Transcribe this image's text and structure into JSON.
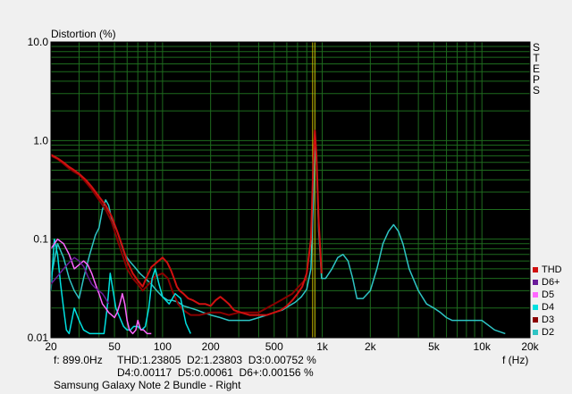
{
  "chart_data": {
    "type": "line",
    "title": "Distortion (%)",
    "xlabel": "f (Hz)",
    "x_scale": "log",
    "y_scale": "log",
    "xlim": [
      20,
      20000
    ],
    "ylim": [
      0.01,
      10.0
    ],
    "y_ticks": [
      "10.0",
      "1.0",
      "0.1",
      "0.01"
    ],
    "x_ticks": [
      {
        "v": 20,
        "label": "20"
      },
      {
        "v": 50,
        "label": "50"
      },
      {
        "v": 100,
        "label": "100"
      },
      {
        "v": 200,
        "label": "200"
      },
      {
        "v": 500,
        "label": "500"
      },
      {
        "v": 1000,
        "label": "1k"
      },
      {
        "v": 2000,
        "label": "2k"
      },
      {
        "v": 5000,
        "label": "5k"
      },
      {
        "v": 10000,
        "label": "10k"
      },
      {
        "v": 20000,
        "label": "20k"
      }
    ],
    "grid": true,
    "background": "#000000",
    "grid_color": "#1e6b1e",
    "cursor_frequency": 899,
    "legend_position": "right",
    "series": [
      {
        "name": "D2",
        "color": "#2ec4c4",
        "points": [
          [
            20,
            0.04
          ],
          [
            22,
            0.09
          ],
          [
            24,
            0.065
          ],
          [
            26,
            0.04
          ],
          [
            28,
            0.03
          ],
          [
            30,
            0.025
          ],
          [
            32,
            0.04
          ],
          [
            35,
            0.07
          ],
          [
            38,
            0.11
          ],
          [
            40,
            0.13
          ],
          [
            42,
            0.2
          ],
          [
            44,
            0.25
          ],
          [
            46,
            0.22
          ],
          [
            48,
            0.16
          ],
          [
            52,
            0.12
          ],
          [
            55,
            0.09
          ],
          [
            58,
            0.07
          ],
          [
            62,
            0.06
          ],
          [
            67,
            0.052
          ],
          [
            72,
            0.045
          ],
          [
            78,
            0.04
          ],
          [
            85,
            0.035
          ],
          [
            92,
            0.03
          ],
          [
            100,
            0.026
          ],
          [
            108,
            0.024
          ],
          [
            115,
            0.024
          ],
          [
            125,
            0.023
          ],
          [
            135,
            0.021
          ],
          [
            150,
            0.02
          ],
          [
            165,
            0.019
          ],
          [
            180,
            0.018
          ],
          [
            200,
            0.017
          ],
          [
            230,
            0.016
          ],
          [
            260,
            0.015
          ],
          [
            300,
            0.015
          ],
          [
            350,
            0.015
          ],
          [
            400,
            0.016
          ],
          [
            450,
            0.017
          ],
          [
            500,
            0.018
          ],
          [
            560,
            0.019
          ],
          [
            620,
            0.021
          ],
          [
            680,
            0.023
          ],
          [
            740,
            0.026
          ],
          [
            800,
            0.031
          ],
          [
            850,
            0.05
          ],
          [
            880,
            0.25
          ],
          [
            899,
            1.23803
          ],
          [
            920,
            0.6
          ],
          [
            950,
            0.12
          ],
          [
            990,
            0.04
          ],
          [
            1050,
            0.04
          ],
          [
            1150,
            0.05
          ],
          [
            1250,
            0.065
          ],
          [
            1350,
            0.07
          ],
          [
            1450,
            0.06
          ],
          [
            1550,
            0.04
          ],
          [
            1650,
            0.025
          ],
          [
            1800,
            0.025
          ],
          [
            2000,
            0.03
          ],
          [
            2200,
            0.05
          ],
          [
            2400,
            0.09
          ],
          [
            2600,
            0.12
          ],
          [
            2800,
            0.14
          ],
          [
            3000,
            0.12
          ],
          [
            3200,
            0.09
          ],
          [
            3500,
            0.05
          ],
          [
            4000,
            0.03
          ],
          [
            4500,
            0.022
          ],
          [
            5000,
            0.02
          ],
          [
            5500,
            0.018
          ],
          [
            6000,
            0.016
          ],
          [
            6500,
            0.015
          ],
          [
            7000,
            0.015
          ],
          [
            8000,
            0.015
          ],
          [
            9000,
            0.015
          ],
          [
            10000,
            0.015
          ],
          [
            12000,
            0.012
          ],
          [
            14000,
            0.011
          ]
        ]
      },
      {
        "name": "D3",
        "color": "#8b0000",
        "points": [
          [
            20,
            0.7
          ],
          [
            22,
            0.65
          ],
          [
            24,
            0.58
          ],
          [
            26,
            0.52
          ],
          [
            28,
            0.48
          ],
          [
            30,
            0.45
          ],
          [
            33,
            0.38
          ],
          [
            36,
            0.32
          ],
          [
            40,
            0.25
          ],
          [
            44,
            0.2
          ],
          [
            48,
            0.15
          ],
          [
            52,
            0.1
          ],
          [
            56,
            0.07
          ],
          [
            60,
            0.05
          ],
          [
            65,
            0.04
          ],
          [
            70,
            0.035
          ],
          [
            75,
            0.03
          ],
          [
            82,
            0.035
          ],
          [
            90,
            0.042
          ],
          [
            100,
            0.045
          ],
          [
            108,
            0.04
          ],
          [
            115,
            0.03
          ],
          [
            125,
            0.022
          ],
          [
            135,
            0.019
          ],
          [
            150,
            0.017
          ],
          [
            170,
            0.017
          ],
          [
            200,
            0.018
          ],
          [
            230,
            0.018
          ],
          [
            260,
            0.017
          ],
          [
            300,
            0.018
          ],
          [
            350,
            0.018
          ],
          [
            400,
            0.018
          ],
          [
            450,
            0.02
          ],
          [
            500,
            0.022
          ],
          [
            550,
            0.024
          ],
          [
            600,
            0.026
          ],
          [
            650,
            0.028
          ],
          [
            700,
            0.032
          ],
          [
            750,
            0.036
          ],
          [
            800,
            0.04
          ]
        ]
      },
      {
        "name": "D4",
        "color": "#00e0e0",
        "points": [
          [
            20,
            0.03
          ],
          [
            21,
            0.1
          ],
          [
            22,
            0.07
          ],
          [
            23,
            0.035
          ],
          [
            24,
            0.02
          ],
          [
            25,
            0.012
          ],
          [
            26,
            0.011
          ],
          [
            28,
            0.02
          ],
          [
            30,
            0.015
          ],
          [
            32,
            0.012
          ],
          [
            35,
            0.011
          ],
          [
            38,
            0.011
          ],
          [
            40,
            0.011
          ],
          [
            43,
            0.011
          ],
          [
            45,
            0.02
          ],
          [
            47,
            0.045
          ],
          [
            49,
            0.03
          ],
          [
            51,
            0.02
          ],
          [
            54,
            0.016
          ],
          [
            57,
            0.013
          ],
          [
            60,
            0.012
          ],
          [
            63,
            0.012
          ],
          [
            66,
            0.013
          ],
          [
            70,
            0.013
          ],
          [
            74,
            0.012
          ],
          [
            78,
            0.013
          ],
          [
            82,
            0.02
          ],
          [
            86,
            0.04
          ],
          [
            90,
            0.05
          ],
          [
            95,
            0.035
          ],
          [
            100,
            0.026
          ],
          [
            110,
            0.022
          ],
          [
            120,
            0.028
          ],
          [
            130,
            0.025
          ],
          [
            140,
            0.014
          ],
          [
            150,
            0.011
          ]
        ]
      },
      {
        "name": "D5",
        "color": "#ff66ff",
        "points": [
          [
            20,
            0.08
          ],
          [
            22,
            0.1
          ],
          [
            24,
            0.09
          ],
          [
            26,
            0.07
          ],
          [
            28,
            0.05
          ],
          [
            30,
            0.055
          ],
          [
            32,
            0.06
          ],
          [
            34,
            0.055
          ],
          [
            36,
            0.045
          ],
          [
            38,
            0.035
          ],
          [
            40,
            0.028
          ],
          [
            42,
            0.022
          ],
          [
            44,
            0.02
          ],
          [
            46,
            0.018
          ],
          [
            48,
            0.017
          ],
          [
            50,
            0.016
          ],
          [
            52,
            0.018
          ],
          [
            54,
            0.022
          ],
          [
            56,
            0.028
          ],
          [
            58,
            0.022
          ],
          [
            60,
            0.015
          ],
          [
            62,
            0.012
          ],
          [
            65,
            0.011
          ],
          [
            68,
            0.012
          ],
          [
            70,
            0.015
          ],
          [
            73,
            0.012
          ],
          [
            76,
            0.012
          ],
          [
            80,
            0.011
          ],
          [
            85,
            0.011
          ]
        ]
      },
      {
        "name": "D6+",
        "color": "#6a1b9a",
        "points": [
          [
            20,
            0.035
          ],
          [
            22,
            0.042
          ],
          [
            24,
            0.05
          ],
          [
            26,
            0.058
          ],
          [
            28,
            0.065
          ],
          [
            30,
            0.06
          ],
          [
            32,
            0.053
          ],
          [
            34,
            0.042
          ],
          [
            36,
            0.035
          ],
          [
            38,
            0.032
          ],
          [
            40,
            0.03
          ],
          [
            42,
            0.028
          ],
          [
            44,
            0.025
          ],
          [
            46,
            0.022
          ]
        ]
      },
      {
        "name": "THD",
        "color": "#d01010",
        "points": [
          [
            20,
            0.72
          ],
          [
            22,
            0.66
          ],
          [
            24,
            0.6
          ],
          [
            26,
            0.54
          ],
          [
            28,
            0.5
          ],
          [
            30,
            0.46
          ],
          [
            33,
            0.4
          ],
          [
            36,
            0.34
          ],
          [
            40,
            0.27
          ],
          [
            44,
            0.22
          ],
          [
            48,
            0.17
          ],
          [
            52,
            0.12
          ],
          [
            56,
            0.085
          ],
          [
            60,
            0.06
          ],
          [
            65,
            0.045
          ],
          [
            70,
            0.038
          ],
          [
            75,
            0.033
          ],
          [
            80,
            0.042
          ],
          [
            85,
            0.052
          ],
          [
            92,
            0.058
          ],
          [
            100,
            0.065
          ],
          [
            107,
            0.058
          ],
          [
            113,
            0.048
          ],
          [
            118,
            0.04
          ],
          [
            123,
            0.033
          ],
          [
            128,
            0.03
          ],
          [
            135,
            0.028
          ],
          [
            145,
            0.025
          ],
          [
            155,
            0.024
          ],
          [
            170,
            0.022
          ],
          [
            185,
            0.022
          ],
          [
            200,
            0.021
          ],
          [
            215,
            0.024
          ],
          [
            230,
            0.026
          ],
          [
            245,
            0.024
          ],
          [
            260,
            0.022
          ],
          [
            280,
            0.019
          ],
          [
            310,
            0.018
          ],
          [
            350,
            0.017
          ],
          [
            400,
            0.017
          ],
          [
            450,
            0.017
          ],
          [
            500,
            0.018
          ],
          [
            550,
            0.019
          ],
          [
            600,
            0.021
          ],
          [
            650,
            0.024
          ],
          [
            700,
            0.028
          ],
          [
            750,
            0.033
          ],
          [
            800,
            0.045
          ],
          [
            850,
            0.1
          ],
          [
            880,
            0.6
          ],
          [
            899,
            1.26
          ],
          [
            920,
            0.7
          ],
          [
            950,
            0.15
          ],
          [
            990,
            0.045
          ]
        ]
      }
    ]
  },
  "side_label": [
    "S",
    "T",
    "E",
    "P",
    "S"
  ],
  "legend": [
    {
      "name": "THD",
      "color": "#d01010"
    },
    {
      "name": "D6+",
      "color": "#6a1b9a"
    },
    {
      "name": "D5",
      "color": "#ff66ff"
    },
    {
      "name": "D4",
      "color": "#00e0e0"
    },
    {
      "name": "D3",
      "color": "#8b0000"
    },
    {
      "name": "D2",
      "color": "#2ec4c4"
    }
  ],
  "readout": {
    "freq": "f: 899.0Hz",
    "line1": "THD:1.23805  D2:1.23803  D3:0.00752 %",
    "line2": "D4:0.00117  D5:0.00061  D6+:0.00156 %"
  },
  "device_label": "Samsung Galaxy Note 2 Bundle - Right"
}
